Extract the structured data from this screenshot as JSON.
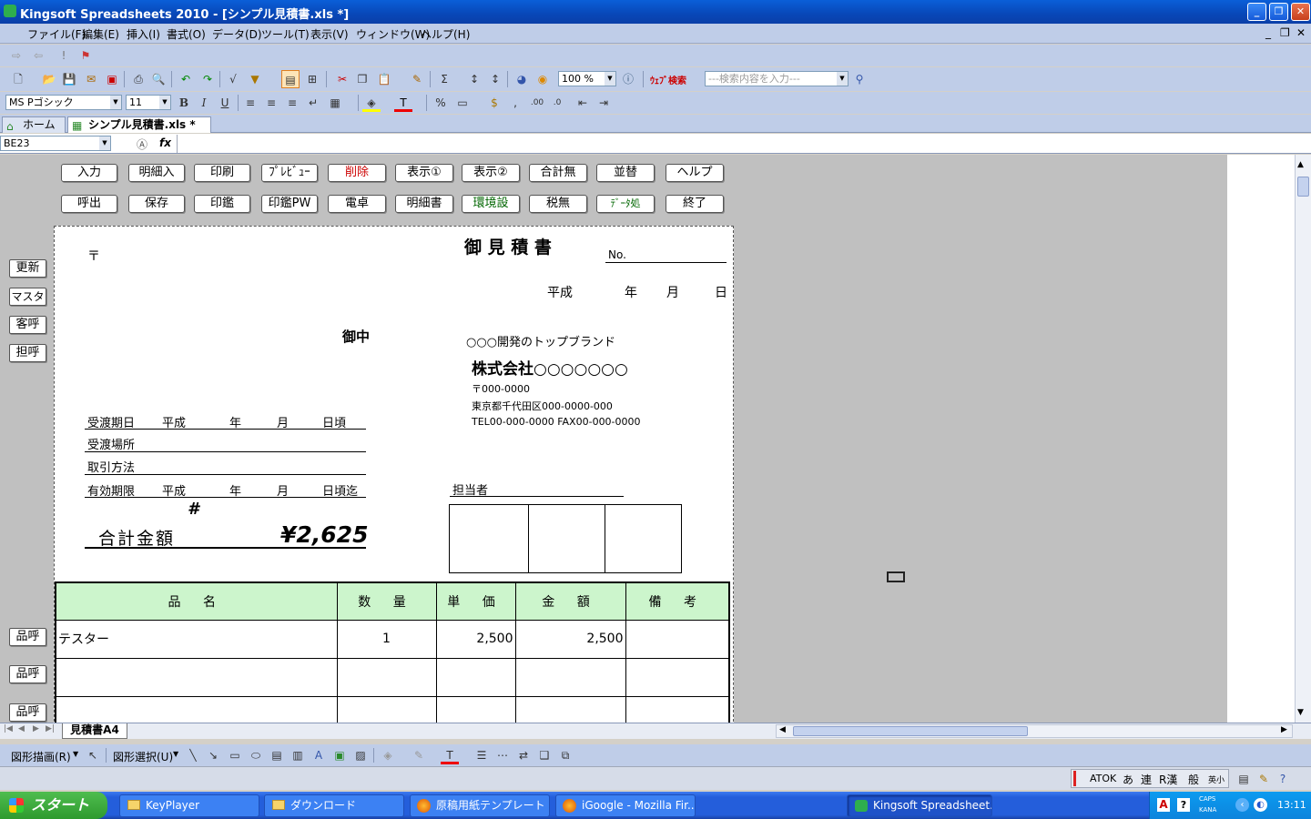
{
  "window": {
    "title": "Kingsoft Spreadsheets 2010 - [シンプル見積書.xls *]"
  },
  "menu": [
    "ファイル(F)",
    "編集(E)",
    "挿入(I)",
    "書式(O)",
    "データ(D)",
    "ツール(T)",
    "表示(V)",
    "ウィンドウ(W)",
    "ヘルプ(H)"
  ],
  "toolbar": {
    "zoom": "100 %",
    "web_search_label": "ｳｪﾌﾞ検索",
    "search_placeholder": "---検索内容を入力---",
    "font_name": "MS Pゴシック",
    "font_size": "11"
  },
  "tabs": [
    {
      "label": "ホーム"
    },
    {
      "label": "シンプル見積書.xls *"
    }
  ],
  "formula": {
    "name_box": "BE23",
    "fx": "fx",
    "value": ""
  },
  "macro_buttons_row1": [
    "入力",
    "明細入",
    "印刷",
    "ﾌﾟﾚﾋﾞｭｰ",
    "削除",
    "表示①",
    "表示②",
    "合計無",
    "並替",
    "ヘルプ"
  ],
  "macro_buttons_row2": [
    "呼出",
    "保存",
    "印鑑",
    "印鑑PW",
    "電卓",
    "明細書",
    "環境設",
    "税無",
    "ﾃﾞｰﾀ処",
    "終了"
  ],
  "side_buttons": [
    "更新",
    "マスタ",
    "客呼",
    "担呼"
  ],
  "item_buttons": [
    "品呼",
    "品呼",
    "品呼"
  ],
  "doc": {
    "title": "御 見 積 書",
    "no_label": "No.",
    "postal_mark": "〒",
    "date_line": [
      "平成",
      "年",
      "月",
      "日"
    ],
    "onchu": "御中",
    "company_tagline": "○○○開発のトップブランド",
    "company_name": "株式会社○○○○○○○",
    "company_postal": "〒000-0000",
    "company_address": "東京都千代田区000-0000-000",
    "company_tel": "TEL00-000-0000 FAX00-000-0000",
    "delivery_date": [
      "受渡期日",
      "平成",
      "年",
      "月",
      "日頃"
    ],
    "delivery_place": "受渡場所",
    "payment": "取引方法",
    "validity": [
      "有効期限",
      "平成",
      "年",
      "月",
      "日頃迄"
    ],
    "staff": "担当者",
    "hash_mark": "#",
    "total_label": "合計金額",
    "total_value": "¥2,625"
  },
  "table": {
    "headers": [
      "品 名",
      "数 量",
      "単 価",
      "金 額",
      "備 考"
    ],
    "rows": [
      [
        "テスター",
        "1",
        "2,500",
        "2,500",
        ""
      ],
      [
        "",
        "",
        "",
        "",
        ""
      ],
      [
        "",
        "",
        "",
        "",
        ""
      ]
    ]
  },
  "sheet_tab": "見積書A4",
  "drawbar": {
    "draw": "図形描画(R)",
    "select": "図形選択(U)"
  },
  "status": {
    "ime": [
      "ATOK",
      "あ",
      "連",
      "R漢",
      "般",
      "英小"
    ]
  },
  "taskbar": {
    "start": "スタート",
    "items": [
      "KeyPlayer",
      "ダウンロード",
      "原稿用紙テンプレート ...",
      "iGoogle - Mozilla Fir...",
      "Kingsoft Spreadsheet..."
    ],
    "tray_caps": "CAPS",
    "tray_kana": "KANA",
    "clock": "13:11"
  }
}
